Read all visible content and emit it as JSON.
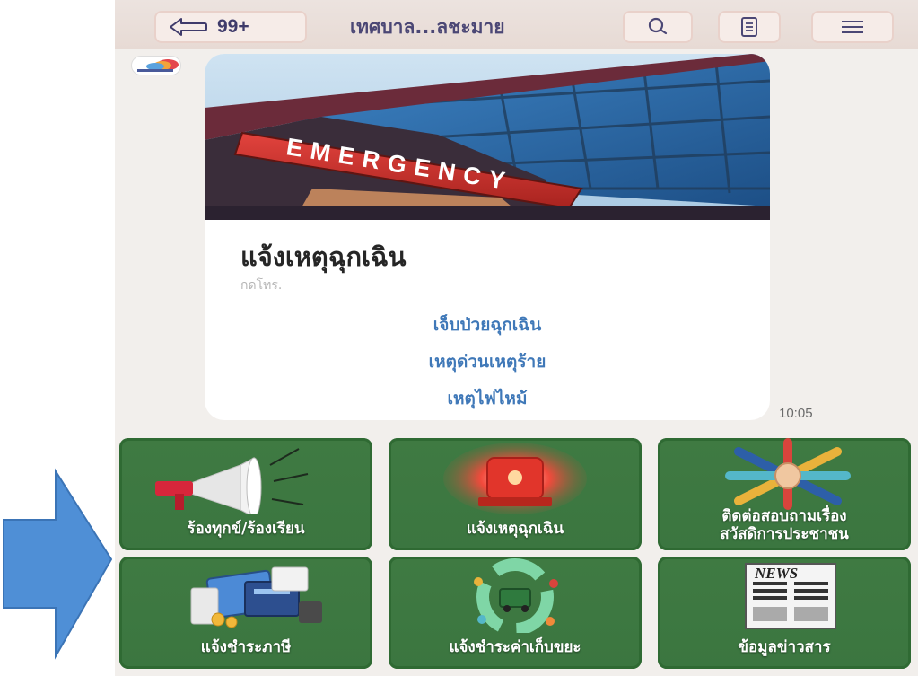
{
  "header": {
    "badge_count": "99+",
    "title": "เทศบาล...ลชะมาย"
  },
  "card": {
    "hero_sign_text": "EMERGENCY",
    "title": "แจ้งเหตุฉุกเฉิน",
    "subtitle": "กดโทร.",
    "links": [
      "เจ็บป่วยฉุกเฉิน",
      "เหตุด่วนเหตุร้าย",
      "เหตุไฟไหม้"
    ]
  },
  "timestamp": "10:05",
  "menu": [
    {
      "label": "ร้องทุกข์/ร้องเรียน",
      "icon": "megaphone-icon"
    },
    {
      "label": "แจ้งเหตุฉุกเฉิน",
      "icon": "siren-icon"
    },
    {
      "label_line1": "ติดต่อสอบถามเรื่อง",
      "label_line2": "สวัสดิการประชาชน",
      "icon": "joined-hands-icon"
    },
    {
      "label": "แจ้งชำระภาษี",
      "icon": "payment-icon"
    },
    {
      "label": "แจ้งชำระค่าเก็บขยะ",
      "icon": "recycle-icon"
    },
    {
      "label": "ข้อมูลข่าวสาร",
      "icon": "newspaper-icon",
      "icon_text": "NEWS"
    }
  ],
  "colors": {
    "tile_green": "#3d7842",
    "link_blue": "#3f78b8",
    "arrow_blue": "#4f8fd6",
    "header_bg": "#ece3df"
  }
}
